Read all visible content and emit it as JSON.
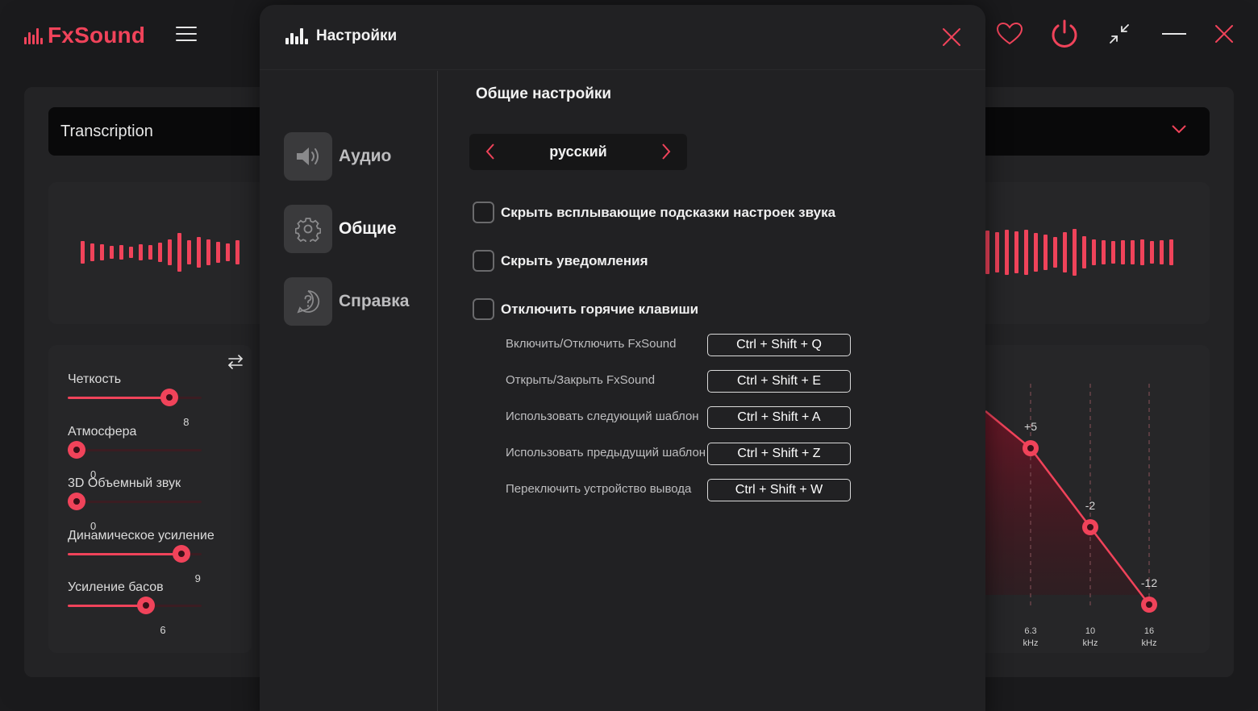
{
  "app": {
    "name": "FxSound",
    "preset": "Transcription",
    "colors": {
      "accent": "#f0435a",
      "background": "#1a1a1c",
      "card": "#262628",
      "dialog": "#212123"
    },
    "titlebar_icons": [
      "heart-icon",
      "power-icon",
      "minimize-window-icon",
      "minimize-icon",
      "close-icon"
    ]
  },
  "effects": {
    "items": [
      {
        "label": "Четкость",
        "value": "8",
        "level": 0.8
      },
      {
        "label": "Атмосфера",
        "value": "0",
        "level": 0.0
      },
      {
        "label": "3D Объемный звук",
        "value": "0",
        "level": 0.0
      },
      {
        "label": "Динамическое усиление",
        "value": "9",
        "level": 0.9
      },
      {
        "label": "Усиление басов",
        "value": "6",
        "level": 0.6
      }
    ]
  },
  "eq": {
    "bands": [
      {
        "gain": "+5",
        "freq": "6.3",
        "unit": "kHz",
        "level": 5
      },
      {
        "gain": "-2",
        "freq": "10",
        "unit": "kHz",
        "level": -2
      },
      {
        "gain": "-12",
        "freq": "16",
        "unit": "kHz",
        "level": -12
      }
    ]
  },
  "settings": {
    "title": "Настройки",
    "nav": [
      {
        "label": "Аудио",
        "icon": "speaker-icon",
        "active": false
      },
      {
        "label": "Общие",
        "icon": "gear-icon",
        "active": true
      },
      {
        "label": "Справка",
        "icon": "help-icon",
        "active": false
      }
    ],
    "section_title": "Общие настройки",
    "language": "русский",
    "checkboxes": [
      {
        "label": "Скрыть всплывающие подсказки настроек звука",
        "checked": false
      },
      {
        "label": "Скрыть уведомления",
        "checked": false
      },
      {
        "label": "Отключить горячие клавиши",
        "checked": false
      }
    ],
    "hotkeys": [
      {
        "label": "Включить/Отключить FxSound",
        "keys": "Ctrl +  Shift + Q"
      },
      {
        "label": "Открыть/Закрыть FxSound",
        "keys": "Ctrl +  Shift + E"
      },
      {
        "label": "Использовать следующий шаблон",
        "keys": "Ctrl +  Shift + A"
      },
      {
        "label": "Использовать предыдущий шаблон",
        "keys": "Ctrl +  Shift + Z"
      },
      {
        "label": "Переключить устройство вывода",
        "keys": "Ctrl +  Shift + W"
      }
    ]
  }
}
